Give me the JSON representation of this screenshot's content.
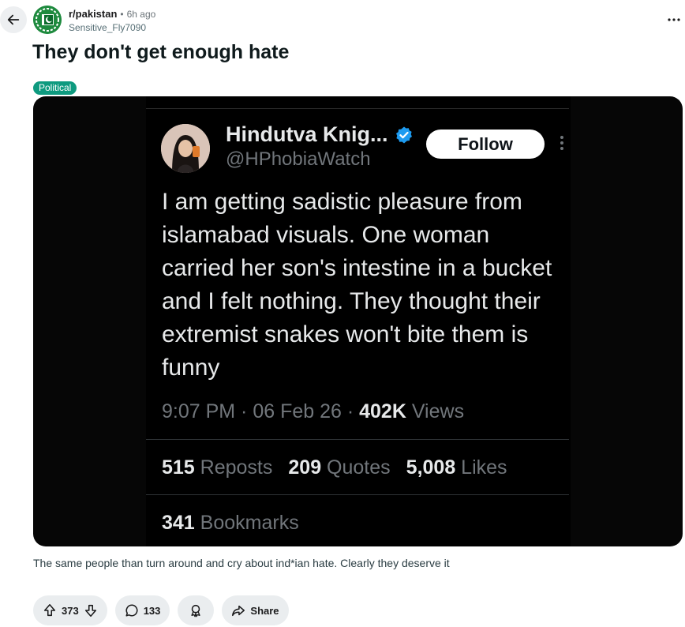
{
  "post": {
    "subreddit": "r/pakistan",
    "separator": "•",
    "age": "6h ago",
    "author": "Sensitive_Fly7090",
    "title": "They don't get enough hate",
    "flair": "Political",
    "body": "The same people than turn around and cry about ind*ian hate. Clearly they deserve it"
  },
  "tweet": {
    "display_name": "Hindutva Knig...",
    "handle": "@HPhobiaWatch",
    "follow_label": "Follow",
    "text": "I am getting sadistic pleasure from islamabad visuals. One woman carried her son's intestine in a bucket and I felt nothing. They thought their extremist snakes won't bite them is funny",
    "timestamp": "9:07 PM · 06 Feb 26 · ",
    "views_count": "402K",
    "views_label": " Views",
    "reposts_count": "515",
    "reposts_label": " Reposts",
    "quotes_count": "209",
    "quotes_label": " Quotes",
    "likes_count": "5,008",
    "likes_label": " Likes",
    "bookmarks_count": "341",
    "bookmarks_label": " Bookmarks"
  },
  "actions": {
    "score": "373",
    "comments": "133",
    "share_label": "Share"
  },
  "colors": {
    "flair": "#0e9a7f",
    "verified": "#1d9bf0",
    "subreddit_icon": "#1e8a3e"
  },
  "icons": {
    "back": "arrow-left-icon",
    "more": "more-horizontal-icon",
    "upvote": "upvote-icon",
    "downvote": "downvote-icon",
    "comment": "comment-icon",
    "award": "award-icon",
    "share": "share-icon",
    "verified": "verified-badge-icon"
  }
}
